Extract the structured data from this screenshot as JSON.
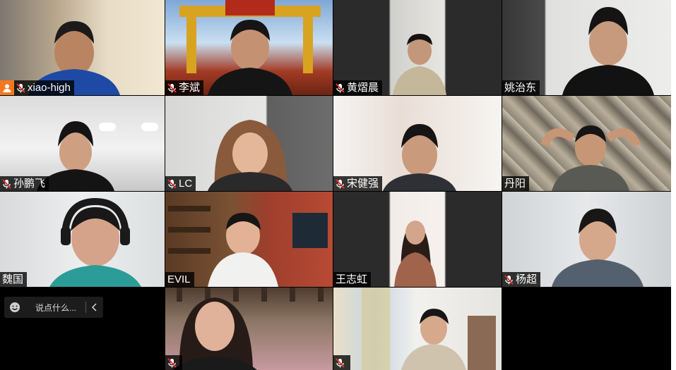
{
  "participants": [
    {
      "name": "xiao-high",
      "muted": true,
      "host": true
    },
    {
      "name": "李斌",
      "muted": true
    },
    {
      "name": "黄熠晨",
      "muted": true
    },
    {
      "name": "姚治东",
      "muted": false
    },
    {
      "name": "孙鹏飞",
      "muted": true
    },
    {
      "name": "LC",
      "muted": true
    },
    {
      "name": "宋健强",
      "muted": true
    },
    {
      "name": "丹阳",
      "muted": false
    },
    {
      "name": "魏国",
      "muted": false
    },
    {
      "name": "EVIL",
      "muted": false
    },
    {
      "name": "王志虹",
      "muted": false
    },
    {
      "name": "杨超",
      "muted": true
    },
    {
      "name": "",
      "muted": true
    },
    {
      "name": "",
      "muted": true
    }
  ],
  "chat": {
    "placeholder": "说点什么..."
  },
  "colors": {
    "host_badge": "#f5781f",
    "mic_muted": "#e0322c",
    "grid_background": "#000000"
  },
  "icons": {
    "host": "person-icon",
    "muted": "mic-muted-icon",
    "emoji": "smiley-icon",
    "collapse": "chevron-left-icon"
  }
}
